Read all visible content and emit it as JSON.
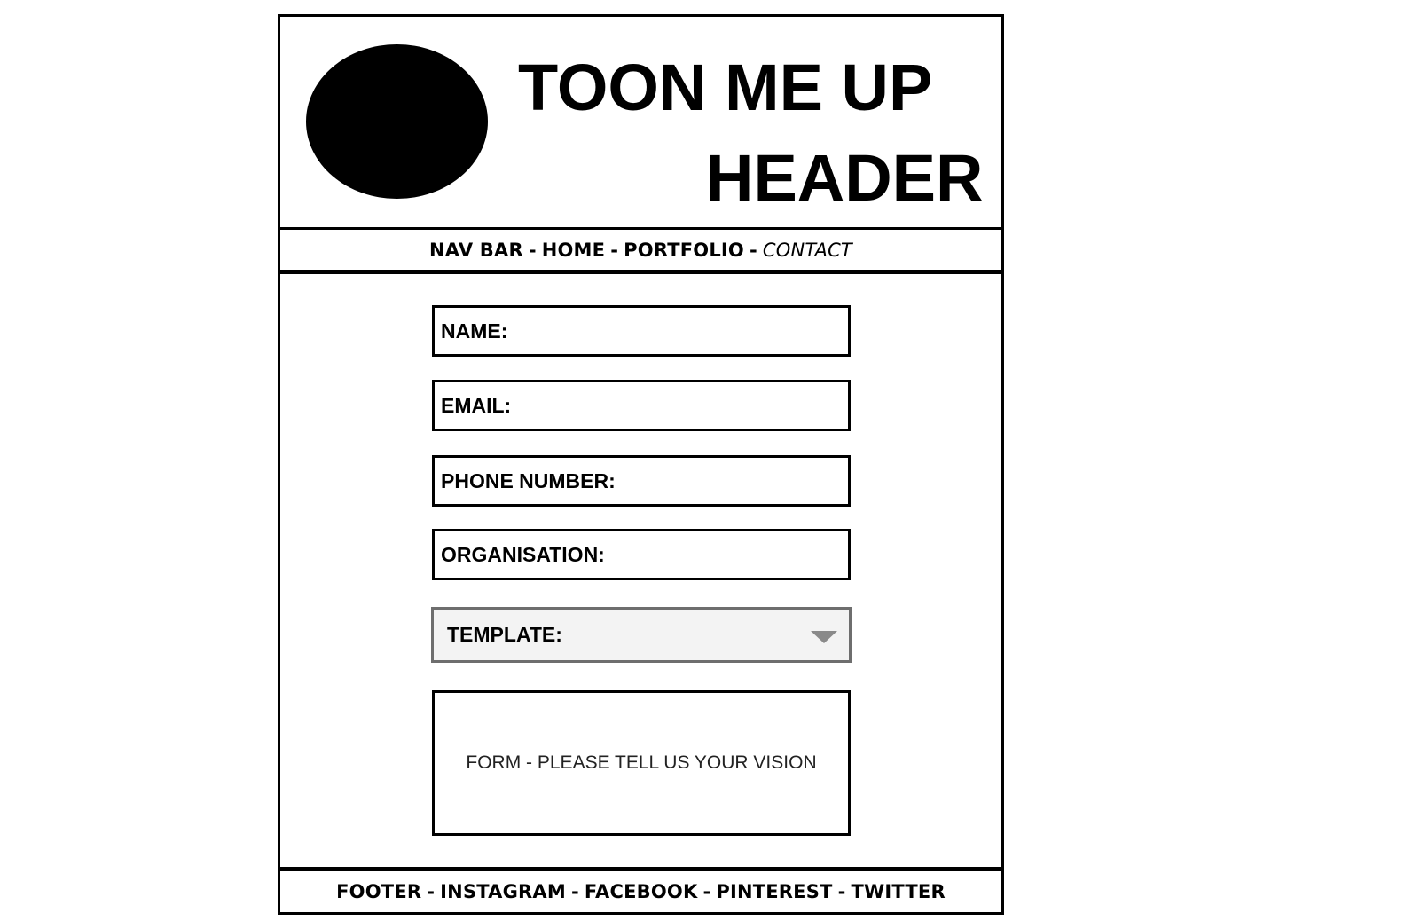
{
  "header": {
    "title_line_1": "TOON ME UP",
    "title_line_2": "HEADER"
  },
  "navbar": {
    "label": "NAV BAR",
    "separator": "-",
    "links": [
      {
        "label": "HOME",
        "active": false
      },
      {
        "label": "PORTFOLIO",
        "active": false
      },
      {
        "label": "CONTACT",
        "active": true
      }
    ]
  },
  "form": {
    "fields": {
      "name": "NAME:",
      "email": "EMAIL:",
      "phone": "PHONE NUMBER:",
      "organisation": "ORGANISATION:"
    },
    "template_select": {
      "label": "TEMPLATE:",
      "icon": "chevron-down-icon"
    },
    "vision_textarea": "FORM - PLEASE TELL US YOUR VISION"
  },
  "footer": {
    "label": "FOOTER",
    "separator": "-",
    "links": [
      "INSTAGRAM",
      "FACEBOOK",
      "PINTEREST",
      "TWITTER"
    ]
  },
  "colors": {
    "border": "#000000",
    "select_border": "#6e6e6e",
    "select_background": "#f3f3f3",
    "select_arrow": "#8a8a8a"
  }
}
